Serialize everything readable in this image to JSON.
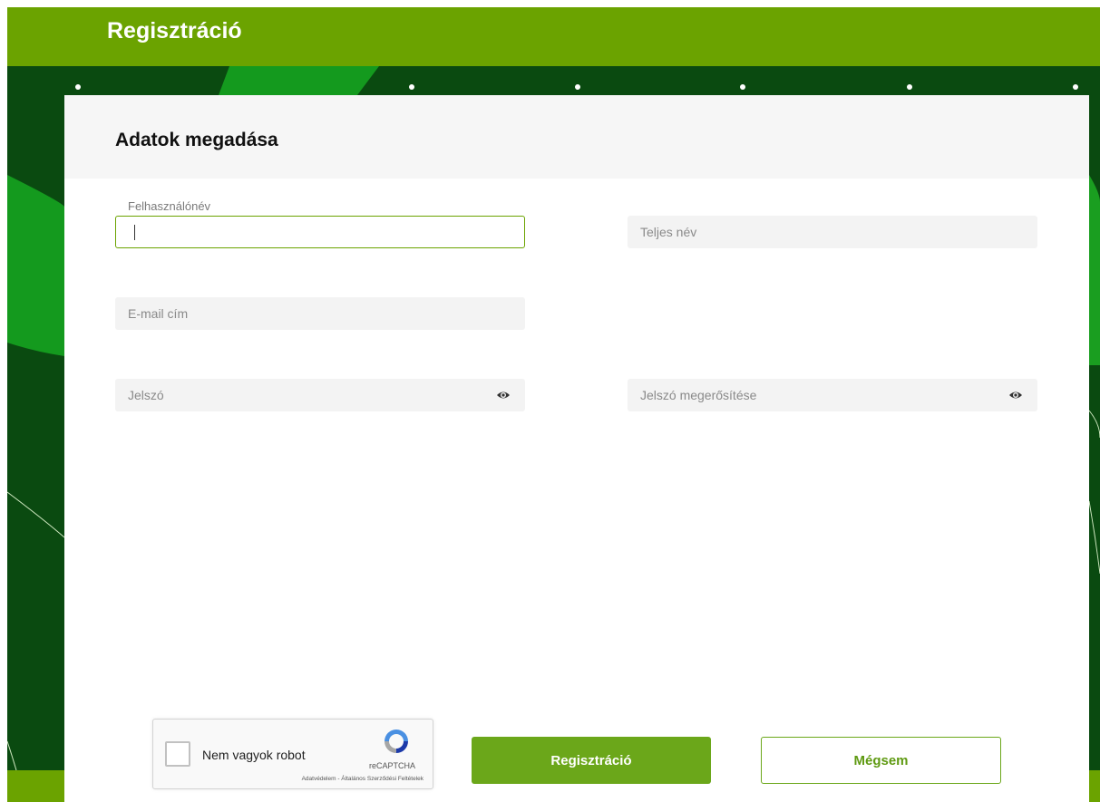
{
  "header": {
    "title": "Regisztráció"
  },
  "card": {
    "title": "Adatok megadása"
  },
  "form": {
    "username": {
      "label": "Felhasználónév",
      "value": ""
    },
    "fullname": {
      "placeholder": "Teljes név"
    },
    "email": {
      "placeholder": "E-mail cím"
    },
    "password": {
      "placeholder": "Jelszó"
    },
    "password_confirm": {
      "placeholder": "Jelszó megerősítése"
    }
  },
  "captcha": {
    "label": "Nem vagyok robot",
    "brand": "reCAPTCHA",
    "links": "Adatvédelem - Általános Szerződési Feltételek"
  },
  "actions": {
    "submit_label": "Regisztráció",
    "cancel_label": "Mégsem"
  },
  "colors": {
    "brand_green": "#6ba300",
    "dark_green": "#0a4a10",
    "button_green": "#6ba71a"
  },
  "icons": {
    "password_toggle": "eye-icon",
    "captcha_logo": "recaptcha-icon"
  }
}
